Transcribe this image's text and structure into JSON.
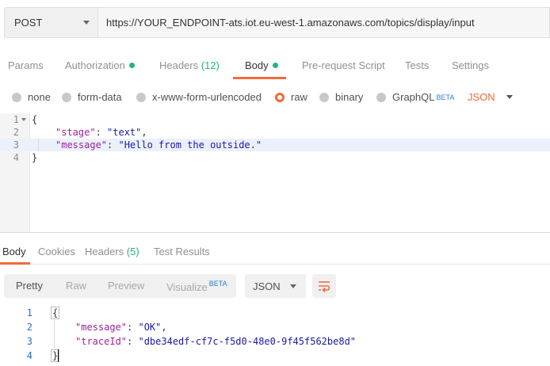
{
  "request": {
    "method": "POST",
    "url": "https://YOUR_ENDPOINT-ats.iot.eu-west-1.amazonaws.com/topics/display/input"
  },
  "request_tabs": {
    "params": "Params",
    "authorization": "Authorization",
    "headers": "Headers",
    "headers_count": "(12)",
    "body": "Body",
    "prerequest": "Pre-request Script",
    "tests": "Tests",
    "settings": "Settings",
    "active": "Body",
    "dot_color": "#26b47f",
    "accent": "#f26b3a"
  },
  "body_options": {
    "none": "none",
    "form_data": "form-data",
    "urlencoded": "x-www-form-urlencoded",
    "raw": "raw",
    "binary": "binary",
    "graphql": "GraphQL",
    "graphql_badge": "BETA",
    "selected": "raw",
    "language": "JSON"
  },
  "request_body": {
    "line_numbers": [
      "1",
      "2",
      "3",
      "4"
    ],
    "open_brace": "{",
    "close_brace": "}",
    "key1": "\"stage\"",
    "val1": "\"text\"",
    "key2": "\"message\"",
    "val2": "\"Hello from the outside.\"",
    "colon": ": ",
    "comma": ","
  },
  "response_tabs": {
    "body": "Body",
    "cookies": "Cookies",
    "headers": "Headers",
    "headers_count": "(5)",
    "test_results": "Test Results",
    "active": "Body"
  },
  "response_toolbar": {
    "pretty": "Pretty",
    "raw": "Raw",
    "preview": "Preview",
    "visualize": "Visualize",
    "visualize_badge": "BETA",
    "format": "JSON",
    "wrap_icon": "wrap-lines-icon"
  },
  "response_body": {
    "line_numbers": [
      "1",
      "2",
      "3",
      "4"
    ],
    "open_brace": "{",
    "close_brace": "}",
    "key1": "\"message\"",
    "val1": "\"OK\"",
    "key2": "\"traceId\"",
    "val2": "\"dbe34edf-cf7c-f5d0-48e0-9f45f562be8d\"",
    "colon": ": ",
    "comma": ","
  }
}
